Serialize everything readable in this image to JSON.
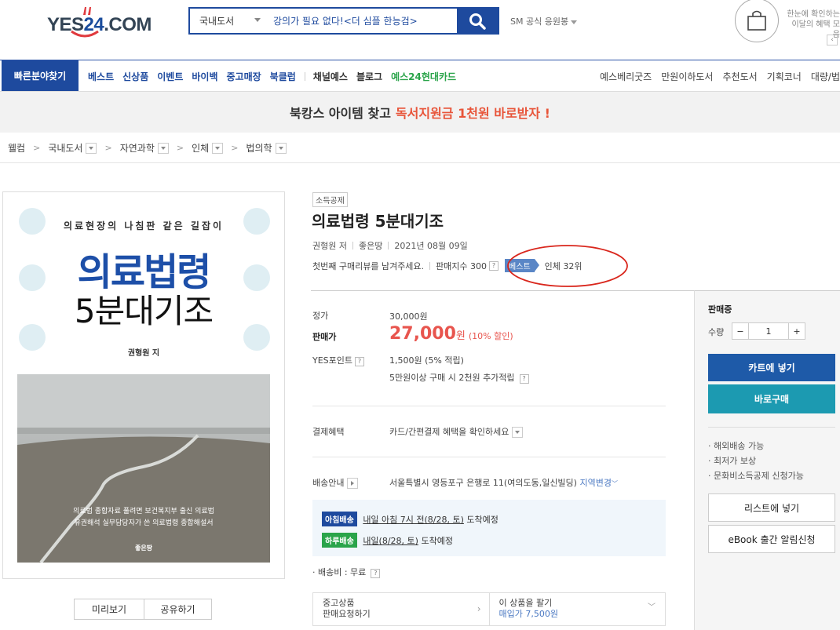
{
  "header": {
    "logo_text_a": "YES",
    "logo_text_num": "24",
    "logo_text_b": ".COM",
    "search_category": "국내도서",
    "search_value": "강의가 필요 없다!<더 심플 한능검>",
    "sm_link": "SM 공식 응원봉",
    "promo_line1": "한눈에 확인하는",
    "promo_line2": "이달의 혜택 모음",
    "promo_arrow": "‹"
  },
  "nav": {
    "quick": "빠른분야찾기",
    "main_items": [
      "베스트",
      "신상품",
      "이벤트",
      "바이백",
      "중고매장",
      "북클럽"
    ],
    "extra_items": [
      "채널예스",
      "블로그"
    ],
    "card_item": "예스24현대카드",
    "right_items": [
      "예스베리굿즈",
      "만원이하도서",
      "추천도서",
      "기획코너",
      "대량/법"
    ]
  },
  "banner": {
    "text": "북캉스 아이템 찾고",
    "highlight": "독서지원금 1천원 바로받자 !"
  },
  "breadcrumb": {
    "home": "웰컴",
    "items": [
      "국내도서",
      "자연과학",
      "인체",
      "법의학"
    ]
  },
  "cover": {
    "subtitle": "의료현장의 나침판 같은 길잡이",
    "title1": "의료법령",
    "title2": "5분대기조",
    "author": "권형원 지",
    "photo_line1": "의료법 종합자료 풀려면 보건복지부 출신 의료법",
    "photo_line2": "유권해석 실무담당자가 쓴 의료법령 종합해설서",
    "publisher": "좋은땅"
  },
  "cover_buttons": {
    "preview": "미리보기",
    "share": "공유하기"
  },
  "product": {
    "tax_badge": "소득공제",
    "title": "의료법령 5분대기조",
    "author": "권형원 저",
    "publisher": "좋은땅",
    "date": "2021년 08월 09일",
    "review_prompt": "첫번째 구매리뷰를 남겨주세요.",
    "sales_index": "판매지수 300",
    "best_tag": "베스트",
    "rank": "인체 32위"
  },
  "price": {
    "list_label": "정가",
    "list_value": "30,000원",
    "sale_label": "판매가",
    "sale_value": "27,000",
    "sale_unit": "원",
    "discount": "(10% 할인)",
    "point_label": "YES포인트",
    "point_value": "1,500원 (5% 적립)",
    "bonus": "5만원이상 구매 시 2천원 추가적립"
  },
  "payment": {
    "label": "결제혜택",
    "value": "카드/간편결제 혜택을 확인하세요"
  },
  "shipping": {
    "label": "배송안내",
    "address": "서울특별시 영등포구 은행로 11(여의도동,일신빌딩)",
    "change": "지역변경",
    "morning_badge": "아침배송",
    "morning_time": "내일 아침 7시 전(8/28, 토)",
    "morning_suffix": "도착예정",
    "next_badge": "하루배송",
    "next_time": "내일(8/28, 토)",
    "next_suffix": "도착예정",
    "fee": "배송비 : 무료"
  },
  "used": {
    "left_line1": "중고상품",
    "left_line2": "판매요청하기",
    "right_line1": "이 상품을 팔기",
    "right_line2": "매입가 7,500원"
  },
  "panel": {
    "status": "판매중",
    "qty_label": "수량",
    "qty_minus": "−",
    "qty_value": "1",
    "qty_plus": "+",
    "cart": "카트에 넣기",
    "buy": "바로구매",
    "benefits": [
      "해외배송 가능",
      "최저가 보상",
      "문화비소득공제 신청가능"
    ],
    "list": "리스트에 넣기",
    "ebook": "eBook 출간 알림신청"
  },
  "colors": {
    "brand_blue": "#1e4a9e",
    "accent_red": "#e8554e",
    "teal": "#1c9ab1"
  }
}
